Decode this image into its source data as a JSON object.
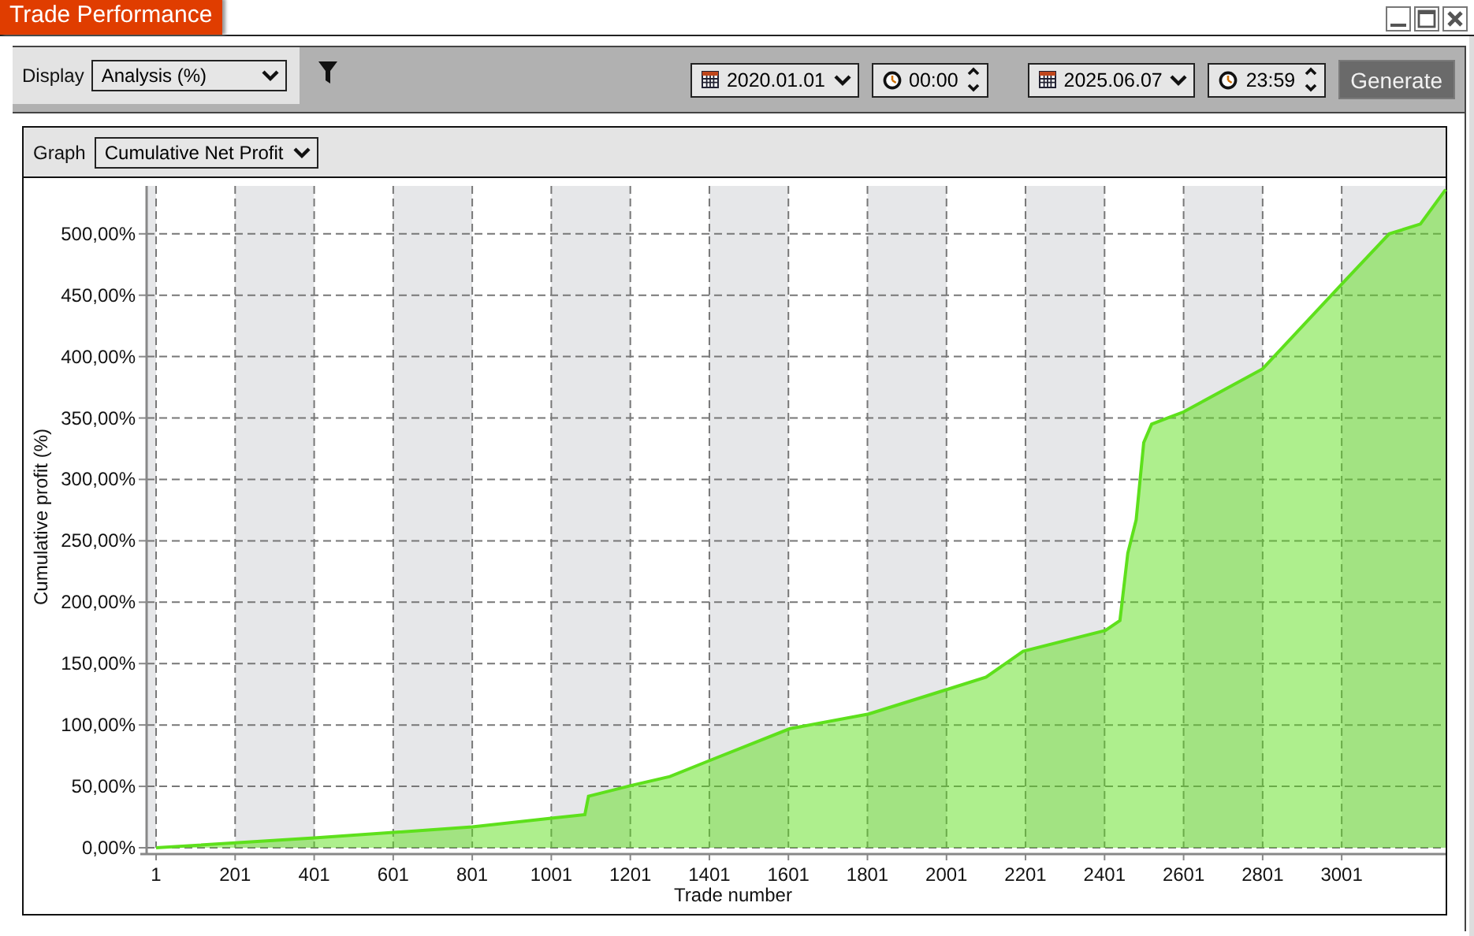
{
  "window": {
    "title": "Trade Performance"
  },
  "toolbar": {
    "display_label": "Display",
    "display_select": "Analysis (%)",
    "date_from": "2020.01.01",
    "time_from": "00:00",
    "date_to": "2025.06.07",
    "time_to": "23:59",
    "generate_button": "Generate"
  },
  "graph_panel": {
    "label": "Graph",
    "select": "Cumulative Net Profit",
    "chart_data": {
      "type": "area",
      "xlabel": "Trade number",
      "ylabel": "Cumulative profit (%)",
      "x": [
        1,
        401,
        801,
        1001,
        1086,
        1095,
        1206,
        1301,
        1393,
        1605,
        1804,
        2003,
        2101,
        2195,
        2403,
        2440,
        2460,
        2481,
        2500,
        2520,
        2560,
        2601,
        2801,
        3001,
        3121,
        3200,
        3264
      ],
      "series": [
        {
          "color": "#5ee01c",
          "values": [
            0,
            8,
            17,
            24,
            27,
            42,
            51,
            58,
            70,
            97,
            109,
            129,
            139,
            160,
            177,
            185,
            240,
            267,
            330,
            345,
            350,
            355,
            390,
            459,
            500,
            508,
            536
          ]
        }
      ],
      "grid": true,
      "xlim": [
        -23,
        3264
      ],
      "ylim": [
        0,
        539
      ],
      "xticks": [
        1,
        201,
        401,
        601,
        801,
        1001,
        1201,
        1401,
        1601,
        1801,
        2001,
        2201,
        2401,
        2601,
        2801,
        3001
      ],
      "yticks": [
        {
          "value": 0,
          "label": "0,00%"
        },
        {
          "value": 50,
          "label": "50,00%"
        },
        {
          "value": 100,
          "label": "100,00%"
        },
        {
          "value": 150,
          "label": "150,00%"
        },
        {
          "value": 200,
          "label": "200,00%"
        },
        {
          "value": 250,
          "label": "250,00%"
        },
        {
          "value": 300,
          "label": "300,00%"
        },
        {
          "value": 350,
          "label": "350,00%"
        },
        {
          "value": 400,
          "label": "400,00%"
        },
        {
          "value": 450,
          "label": "450,00%"
        },
        {
          "value": 500,
          "label": "500,00%"
        }
      ]
    }
  }
}
